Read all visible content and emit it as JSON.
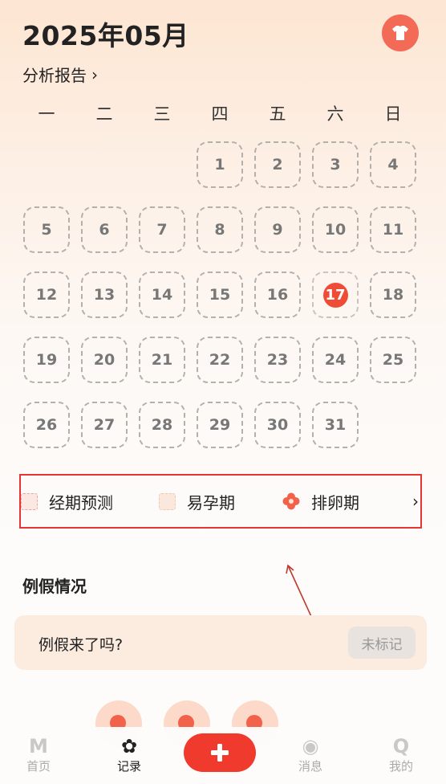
{
  "header": {
    "title": "2025年05月",
    "report_label": "分析报告",
    "report_chevron": "›",
    "avatar_icon": "shirt-icon",
    "accent": "#f36a57"
  },
  "calendar": {
    "weekdays": [
      "一",
      "二",
      "三",
      "四",
      "五",
      "六",
      "日"
    ],
    "first_weekday_index": 3,
    "days": [
      "1",
      "2",
      "3",
      "4",
      "5",
      "6",
      "7",
      "8",
      "9",
      "10",
      "11",
      "12",
      "13",
      "14",
      "15",
      "16",
      "17",
      "18",
      "19",
      "20",
      "21",
      "22",
      "23",
      "24",
      "25",
      "26",
      "27",
      "28",
      "29",
      "30",
      "31"
    ],
    "today": "17",
    "today_color": "#ef4c38"
  },
  "legend": {
    "items": [
      {
        "label": "经期预测",
        "icon": "period-square-icon"
      },
      {
        "label": "易孕期",
        "icon": "fertile-square-icon"
      },
      {
        "label": "排卵期",
        "icon": "ovulation-flower-icon"
      }
    ],
    "more": "›"
  },
  "period_section": {
    "title": "例假情况",
    "question": "例假来了吗?",
    "button": "未标记"
  },
  "tabbar": {
    "items": [
      {
        "label": "首页",
        "icon": "home-m-icon",
        "glyph": "M",
        "active": false
      },
      {
        "label": "记录",
        "icon": "record-flower-icon",
        "glyph": "✿",
        "active": true
      },
      {
        "label": "消息",
        "icon": "message-icon",
        "glyph": "◉",
        "active": false
      },
      {
        "label": "我的",
        "icon": "profile-q-icon",
        "glyph": "Q",
        "active": false
      }
    ],
    "add_icon": "plus-icon",
    "add_color": "#ef3a2d"
  }
}
